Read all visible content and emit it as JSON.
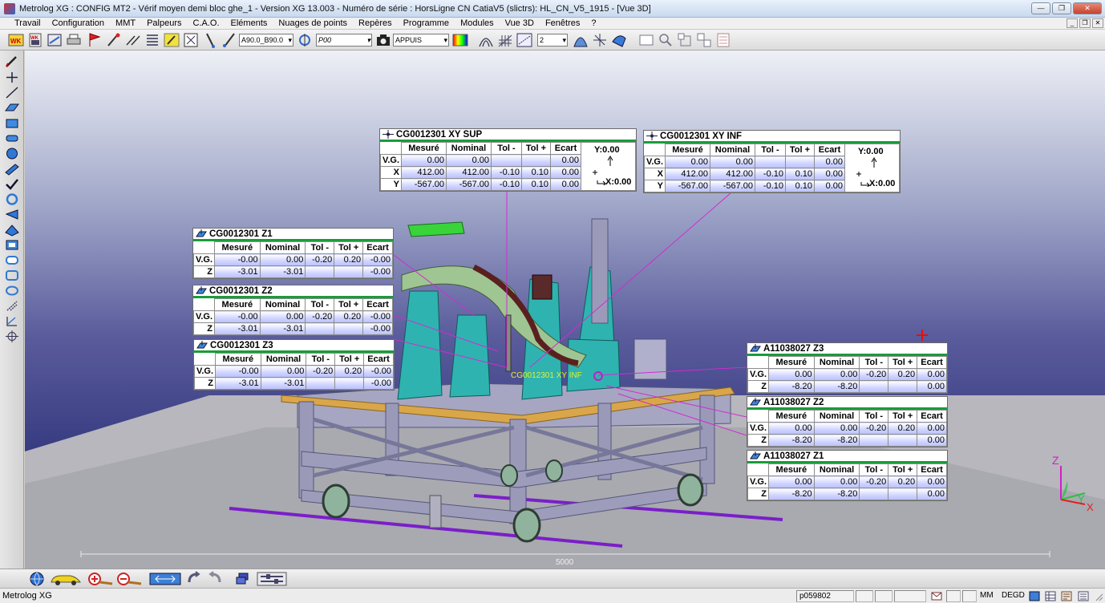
{
  "window": {
    "title": "Metrolog XG : CONFIG MT2 - Vérif moyen demi bloc ghe_1 - Version XG 13.003 - Numéro de série : HorsLigne CN CatiaV5  (slictrs): HL_CN_V5_1915 - [Vue 3D]",
    "controls": [
      "—",
      "❐",
      "✕"
    ]
  },
  "menu": {
    "items": [
      "Travail",
      "Configuration",
      "MMT",
      "Palpeurs",
      "C.A.O.",
      "Eléments",
      "Nuages de points",
      "Repères",
      "Programme",
      "Modules",
      "Vue 3D",
      "Fenêtres",
      "?"
    ],
    "mdi_controls": [
      "_",
      "❐",
      "✕"
    ]
  },
  "toolbar": {
    "probe_select": "A90.0_B90.0",
    "point_select": "P00",
    "mode_select": "APPUIS",
    "count_select": "2"
  },
  "viewport": {
    "scale_label": "5000",
    "overlay_label": "CG0012301 XY INF",
    "triad": {
      "z": "Z",
      "y": "Y",
      "x": "X"
    }
  },
  "headers": {
    "mesure": "Mesuré",
    "nominal": "Nominal",
    "tol_minus": "Tol -",
    "tol_plus": "Tol +",
    "ecart": "Ecart"
  },
  "cards": {
    "xy_sup": {
      "title": "CG0012301 XY SUP",
      "rows": [
        {
          "label": "V.G.",
          "mesure": "0.00",
          "nominal": "0.00",
          "tol_minus": "",
          "tol_plus": "",
          "ecart": "0.00"
        },
        {
          "label": "X",
          "mesure": "412.00",
          "nominal": "412.00",
          "tol_minus": "-0.10",
          "tol_plus": "0.10",
          "ecart": "0.00"
        },
        {
          "label": "Y",
          "mesure": "-567.00",
          "nominal": "-567.00",
          "tol_minus": "-0.10",
          "tol_plus": "0.10",
          "ecart": "0.00"
        }
      ],
      "axis_y": "Y:0.00",
      "axis_x": "X:0.00"
    },
    "xy_inf": {
      "title": "CG0012301 XY INF",
      "rows": [
        {
          "label": "V.G.",
          "mesure": "0.00",
          "nominal": "0.00",
          "tol_minus": "",
          "tol_plus": "",
          "ecart": "0.00"
        },
        {
          "label": "X",
          "mesure": "412.00",
          "nominal": "412.00",
          "tol_minus": "-0.10",
          "tol_plus": "0.10",
          "ecart": "0.00"
        },
        {
          "label": "Y",
          "mesure": "-567.00",
          "nominal": "-567.00",
          "tol_minus": "-0.10",
          "tol_plus": "0.10",
          "ecart": "0.00"
        }
      ],
      "axis_y": "Y:0.00",
      "axis_x": "X:0.00"
    },
    "z1": {
      "title": "CG0012301 Z1",
      "rows": [
        {
          "label": "V.G.",
          "mesure": "-0.00",
          "nominal": "0.00",
          "tol_minus": "-0.20",
          "tol_plus": "0.20",
          "ecart": "-0.00"
        },
        {
          "label": "Z",
          "mesure": "-3.01",
          "nominal": "-3.01",
          "tol_minus": "",
          "tol_plus": "",
          "ecart": "-0.00"
        }
      ]
    },
    "z2": {
      "title": "CG0012301 Z2",
      "rows": [
        {
          "label": "V.G.",
          "mesure": "-0.00",
          "nominal": "0.00",
          "tol_minus": "-0.20",
          "tol_plus": "0.20",
          "ecart": "-0.00"
        },
        {
          "label": "Z",
          "mesure": "-3.01",
          "nominal": "-3.01",
          "tol_minus": "",
          "tol_plus": "",
          "ecart": "-0.00"
        }
      ]
    },
    "z3": {
      "title": "CG0012301 Z3",
      "rows": [
        {
          "label": "V.G.",
          "mesure": "-0.00",
          "nominal": "0.00",
          "tol_minus": "-0.20",
          "tol_plus": "0.20",
          "ecart": "-0.00"
        },
        {
          "label": "Z",
          "mesure": "-3.01",
          "nominal": "-3.01",
          "tol_minus": "",
          "tol_plus": "",
          "ecart": "-0.00"
        }
      ]
    },
    "a_z3": {
      "title": "A11038027 Z3",
      "rows": [
        {
          "label": "V.G.",
          "mesure": "0.00",
          "nominal": "0.00",
          "tol_minus": "-0.20",
          "tol_plus": "0.20",
          "ecart": "0.00"
        },
        {
          "label": "Z",
          "mesure": "-8.20",
          "nominal": "-8.20",
          "tol_minus": "",
          "tol_plus": "",
          "ecart": "0.00"
        }
      ]
    },
    "a_z2": {
      "title": "A11038027 Z2",
      "rows": [
        {
          "label": "V.G.",
          "mesure": "0.00",
          "nominal": "0.00",
          "tol_minus": "-0.20",
          "tol_plus": "0.20",
          "ecart": "0.00"
        },
        {
          "label": "Z",
          "mesure": "-8.20",
          "nominal": "-8.20",
          "tol_minus": "",
          "tol_plus": "",
          "ecart": "0.00"
        }
      ]
    },
    "a_z1": {
      "title": "A11038027 Z1",
      "rows": [
        {
          "label": "V.G.",
          "mesure": "0.00",
          "nominal": "0.00",
          "tol_minus": "-0.20",
          "tol_plus": "0.20",
          "ecart": "0.00"
        },
        {
          "label": "Z",
          "mesure": "-8.20",
          "nominal": "-8.20",
          "tol_minus": "",
          "tol_plus": "",
          "ecart": "0.00"
        }
      ]
    }
  },
  "status": {
    "app": "Metrolog XG",
    "code": "p059802",
    "units": "MM",
    "angle_units": "DEGD"
  }
}
